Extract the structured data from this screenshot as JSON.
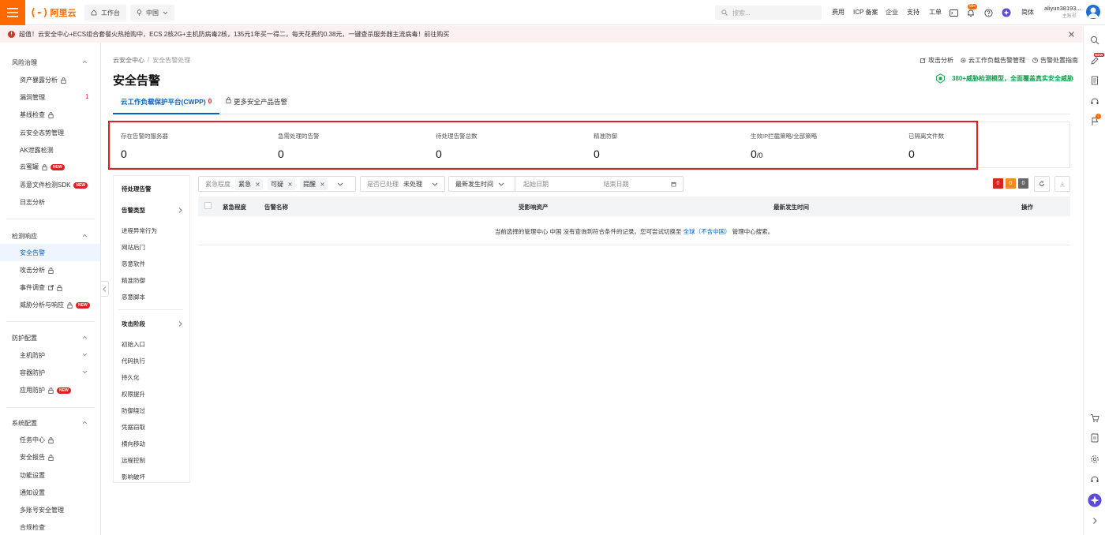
{
  "header": {
    "logo_bracket": "(-)",
    "logo_text": "阿里云",
    "workbench": "工作台",
    "region": "中国",
    "search_placeholder": "搜索...",
    "nav": [
      "费用",
      "ICP 备案",
      "企业",
      "支持",
      "工单"
    ],
    "notify_badge": "99+",
    "lang": "简体",
    "user_name": "aliyun38193...",
    "user_role": "主账号"
  },
  "promo": {
    "text": "超值！云安全中心+ECS组合套餐火热抢购中，ECS 2核2G+主机防病毒2核，135元1年买一得二，每天花费约0.38元，一键查杀服务器主流病毒！前往购买"
  },
  "sidebar": {
    "groups": [
      {
        "title": "风险治理",
        "items": [
          "资产暴露分析",
          "漏洞管理",
          "基线检查",
          "云安全态势管理",
          "AK泄露检测",
          "云蜜罐",
          "恶意文件检测SDK",
          "日志分析"
        ]
      },
      {
        "title": "检测响应",
        "items": [
          "安全告警",
          "攻击分析",
          "事件调查",
          "威胁分析与响应"
        ]
      },
      {
        "title": "防护配置",
        "items": [
          "主机防护",
          "容器防护",
          "应用防护"
        ]
      },
      {
        "title": "系统配置",
        "items": [
          "任务中心",
          "安全报告",
          "功能设置",
          "通知设置",
          "多账号安全管理",
          "合规检查"
        ]
      }
    ],
    "vuln_count": "1",
    "new_label": "NEW"
  },
  "main": {
    "breadcrumb": [
      "云安全中心",
      "/",
      "安全告警处理"
    ],
    "title": "安全告警",
    "links": [
      "攻击分析",
      "云工作负载告警管理",
      "告警处置指南"
    ],
    "promo_link": "380+威胁检测模型，全面覆盖真实安全威胁",
    "tabs": {
      "cwpp": "云工作负载保护平台(CWPP)",
      "cwpp_count": "0",
      "more": "更多安全产品告警"
    },
    "stats": [
      {
        "label": "存在告警的服务器",
        "value": "0"
      },
      {
        "label": "急需处理的告警",
        "value": "0"
      },
      {
        "label": "待处理告警总数",
        "value": "0"
      },
      {
        "label": "精准防御",
        "value": "0"
      },
      {
        "label": "生效IP拦截策略/全部策略",
        "value": "0",
        "suffix": "/0"
      },
      {
        "label": "已隔离文件数",
        "value": "0"
      }
    ]
  },
  "filter_panel": {
    "pending": "待处理告警",
    "type_head": "告警类型",
    "types": [
      "进程异常行为",
      "网站后门",
      "恶意软件",
      "精准防御",
      "恶意脚本"
    ],
    "stage_head": "攻击阶段",
    "stages": [
      "初始入口",
      "代码执行",
      "持久化",
      "权限提升",
      "防御绕过",
      "凭据窃取",
      "横向移动",
      "远程控制",
      "影响破坏"
    ]
  },
  "filters": {
    "severity_label": "紧急程度",
    "severity_tags": [
      "紧急",
      "可疑",
      "提醒"
    ],
    "handled_label": "是否已处理",
    "handled_value": "未处理",
    "time_label": "最新发生时间",
    "start_placeholder": "起始日期",
    "end_placeholder": "结束日期",
    "counts": [
      "0",
      "0",
      "0"
    ],
    "count_colors": [
      "#d9261c",
      "#f08a24",
      "#666666"
    ]
  },
  "table": {
    "headers": [
      "紧急程度",
      "告警名称",
      "受影响资产",
      "最新发生时间",
      "操作"
    ],
    "empty_prefix": "当前选择的管理中心 中国 没有查询到符合条件的记录。您可尝试切换至",
    "empty_link": "全球（不含中国）",
    "empty_suffix": "管理中心搜索。"
  }
}
